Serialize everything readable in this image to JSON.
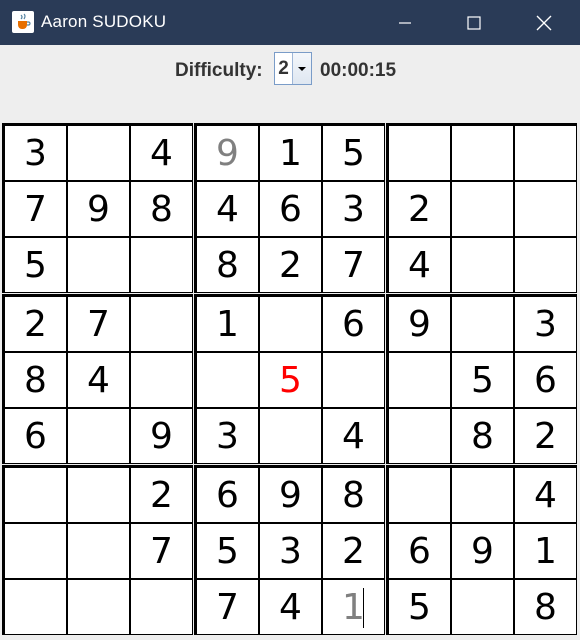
{
  "window": {
    "title": "Aaron SUDOKU",
    "icons": {
      "app": "java-cup-icon",
      "minimize": "minimize-icon",
      "maximize": "maximize-icon",
      "close": "close-icon"
    },
    "titlebar_color": "#2a3b57"
  },
  "toolbar": {
    "difficulty_label": "Difficulty:",
    "difficulty_value": "2",
    "timer": "00:00:15"
  },
  "board": {
    "cells": [
      [
        {
          "v": "3",
          "s": "given"
        },
        {
          "v": "",
          "s": "empty"
        },
        {
          "v": "4",
          "s": "given"
        },
        {
          "v": "9",
          "s": "hint"
        },
        {
          "v": "1",
          "s": "given"
        },
        {
          "v": "5",
          "s": "given"
        },
        {
          "v": "",
          "s": "empty"
        },
        {
          "v": "",
          "s": "empty"
        },
        {
          "v": "",
          "s": "empty"
        }
      ],
      [
        {
          "v": "7",
          "s": "given"
        },
        {
          "v": "9",
          "s": "given"
        },
        {
          "v": "8",
          "s": "given"
        },
        {
          "v": "4",
          "s": "given"
        },
        {
          "v": "6",
          "s": "given"
        },
        {
          "v": "3",
          "s": "given"
        },
        {
          "v": "2",
          "s": "given"
        },
        {
          "v": "",
          "s": "empty"
        },
        {
          "v": "",
          "s": "empty"
        }
      ],
      [
        {
          "v": "5",
          "s": "given"
        },
        {
          "v": "",
          "s": "empty"
        },
        {
          "v": "",
          "s": "empty"
        },
        {
          "v": "8",
          "s": "given"
        },
        {
          "v": "2",
          "s": "given"
        },
        {
          "v": "7",
          "s": "given"
        },
        {
          "v": "4",
          "s": "given"
        },
        {
          "v": "",
          "s": "empty"
        },
        {
          "v": "",
          "s": "empty"
        }
      ],
      [
        {
          "v": "2",
          "s": "given"
        },
        {
          "v": "7",
          "s": "given"
        },
        {
          "v": "",
          "s": "empty"
        },
        {
          "v": "1",
          "s": "given"
        },
        {
          "v": "",
          "s": "empty"
        },
        {
          "v": "6",
          "s": "given"
        },
        {
          "v": "9",
          "s": "given"
        },
        {
          "v": "",
          "s": "empty"
        },
        {
          "v": "3",
          "s": "given"
        }
      ],
      [
        {
          "v": "8",
          "s": "given"
        },
        {
          "v": "4",
          "s": "given"
        },
        {
          "v": "",
          "s": "empty"
        },
        {
          "v": "",
          "s": "empty"
        },
        {
          "v": "5",
          "s": "error"
        },
        {
          "v": "",
          "s": "empty"
        },
        {
          "v": "",
          "s": "empty"
        },
        {
          "v": "5",
          "s": "given"
        },
        {
          "v": "6",
          "s": "given"
        }
      ],
      [
        {
          "v": "6",
          "s": "given"
        },
        {
          "v": "",
          "s": "empty"
        },
        {
          "v": "9",
          "s": "given"
        },
        {
          "v": "3",
          "s": "given"
        },
        {
          "v": "",
          "s": "empty"
        },
        {
          "v": "4",
          "s": "given"
        },
        {
          "v": "",
          "s": "empty"
        },
        {
          "v": "8",
          "s": "given"
        },
        {
          "v": "2",
          "s": "given"
        }
      ],
      [
        {
          "v": "",
          "s": "empty"
        },
        {
          "v": "",
          "s": "empty"
        },
        {
          "v": "2",
          "s": "given"
        },
        {
          "v": "6",
          "s": "given"
        },
        {
          "v": "9",
          "s": "given"
        },
        {
          "v": "8",
          "s": "given"
        },
        {
          "v": "",
          "s": "empty"
        },
        {
          "v": "",
          "s": "empty"
        },
        {
          "v": "4",
          "s": "given"
        }
      ],
      [
        {
          "v": "",
          "s": "empty"
        },
        {
          "v": "",
          "s": "empty"
        },
        {
          "v": "7",
          "s": "given"
        },
        {
          "v": "5",
          "s": "given"
        },
        {
          "v": "3",
          "s": "given"
        },
        {
          "v": "2",
          "s": "given"
        },
        {
          "v": "6",
          "s": "given"
        },
        {
          "v": "9",
          "s": "given"
        },
        {
          "v": "1",
          "s": "given"
        }
      ],
      [
        {
          "v": "",
          "s": "empty"
        },
        {
          "v": "",
          "s": "empty"
        },
        {
          "v": "",
          "s": "empty"
        },
        {
          "v": "7",
          "s": "given"
        },
        {
          "v": "4",
          "s": "given"
        },
        {
          "v": "1",
          "s": "hint-focused"
        },
        {
          "v": "5",
          "s": "given"
        },
        {
          "v": "",
          "s": "empty"
        },
        {
          "v": "8",
          "s": "given"
        }
      ]
    ],
    "colors": {
      "given": "#000000",
      "hint": "#808080",
      "error": "#ff0000"
    }
  }
}
